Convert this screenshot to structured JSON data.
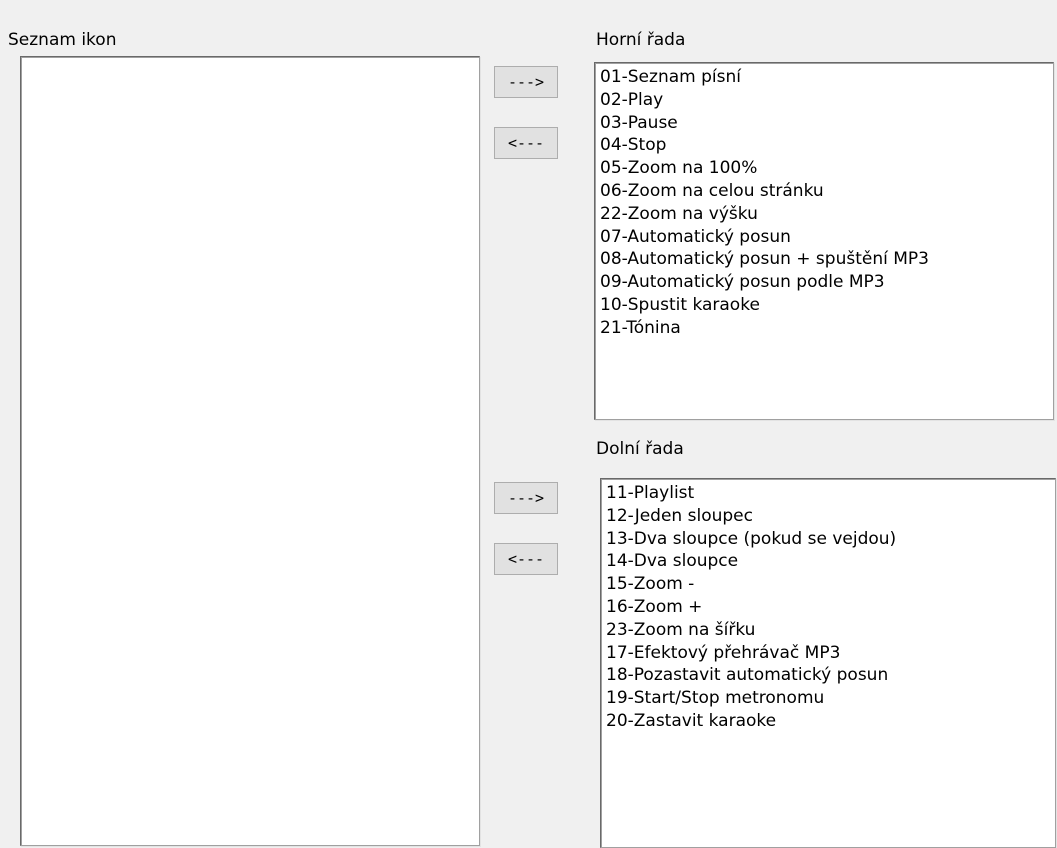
{
  "left": {
    "label": "Seznam ikon",
    "items": []
  },
  "top": {
    "label": "Horní řada",
    "items": [
      "01-Seznam písní",
      "02-Play",
      "03-Pause",
      "04-Stop",
      "05-Zoom na 100%",
      "06-Zoom na celou stránku",
      "22-Zoom na výšku",
      "07-Automatický posun",
      "08-Automatický posun + spuštění MP3",
      "09-Automatický posun podle MP3",
      "10-Spustit karaoke",
      "21-Tónina"
    ],
    "add_label": "--->",
    "remove_label": "<---"
  },
  "bottom": {
    "label": "Dolní řada",
    "items": [
      "11-Playlist",
      "12-Jeden sloupec",
      "13-Dva sloupce (pokud se vejdou)",
      "14-Dva sloupce",
      "15-Zoom -",
      "16-Zoom +",
      "23-Zoom na šířku",
      "17-Efektový přehrávač MP3",
      "18-Pozastavit automatický posun",
      "19-Start/Stop metronomu",
      "20-Zastavit karaoke"
    ],
    "add_label": "--->",
    "remove_label": "<---"
  }
}
